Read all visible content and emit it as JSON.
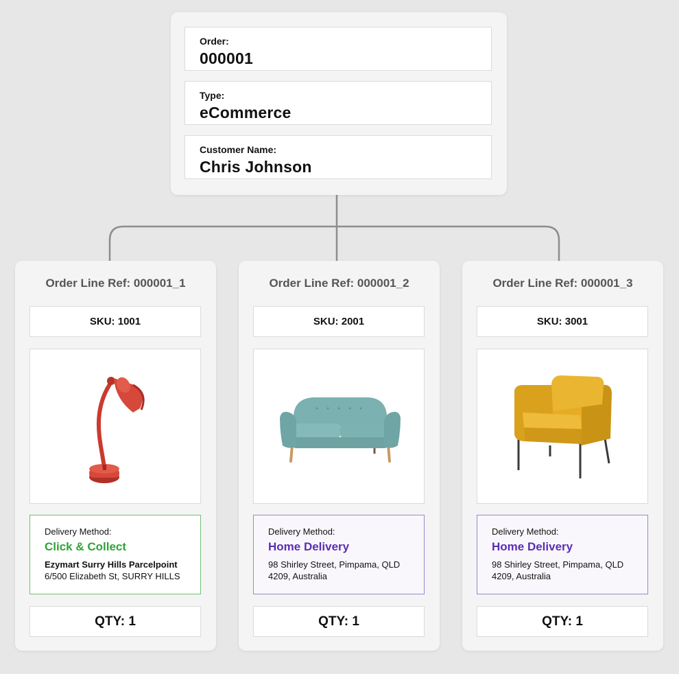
{
  "order": {
    "order_label": "Order:",
    "order_value": "000001",
    "type_label": "Type:",
    "type_value": "eCommerce",
    "customer_label": "Customer Name:",
    "customer_value": "Chris Johnson"
  },
  "lines": [
    {
      "title": "Order Line Ref: 000001_1",
      "sku": "SKU: 1001",
      "product_icon": "desk-lamp",
      "delivery_label": "Delivery Method:",
      "delivery_method": "Click & Collect",
      "address_line1": "Ezymart Surry Hills Parcelpoint",
      "address_line2": "6/500 Elizabeth St, SURRY HILLS",
      "qty": "QTY: 1"
    },
    {
      "title": "Order Line Ref: 000001_2",
      "sku": "SKU: 2001",
      "product_icon": "sofa",
      "delivery_label": "Delivery Method:",
      "delivery_method": "Home Delivery",
      "address_line1": "98 Shirley Street, Pimpama, QLD",
      "address_line2": "4209, Australia",
      "qty": "QTY: 1"
    },
    {
      "title": "Order Line Ref: 000001_3",
      "sku": "SKU: 3001",
      "product_icon": "armchair",
      "delivery_label": "Delivery Method:",
      "delivery_method": "Home Delivery",
      "address_line1": "98 Shirley Street, Pimpama, QLD",
      "address_line2": "4209, Australia",
      "qty": "QTY: 1"
    }
  ],
  "colors": {
    "click_collect": "#2ea438",
    "home_delivery": "#5a2db4",
    "connector": "#8d8d8d"
  }
}
